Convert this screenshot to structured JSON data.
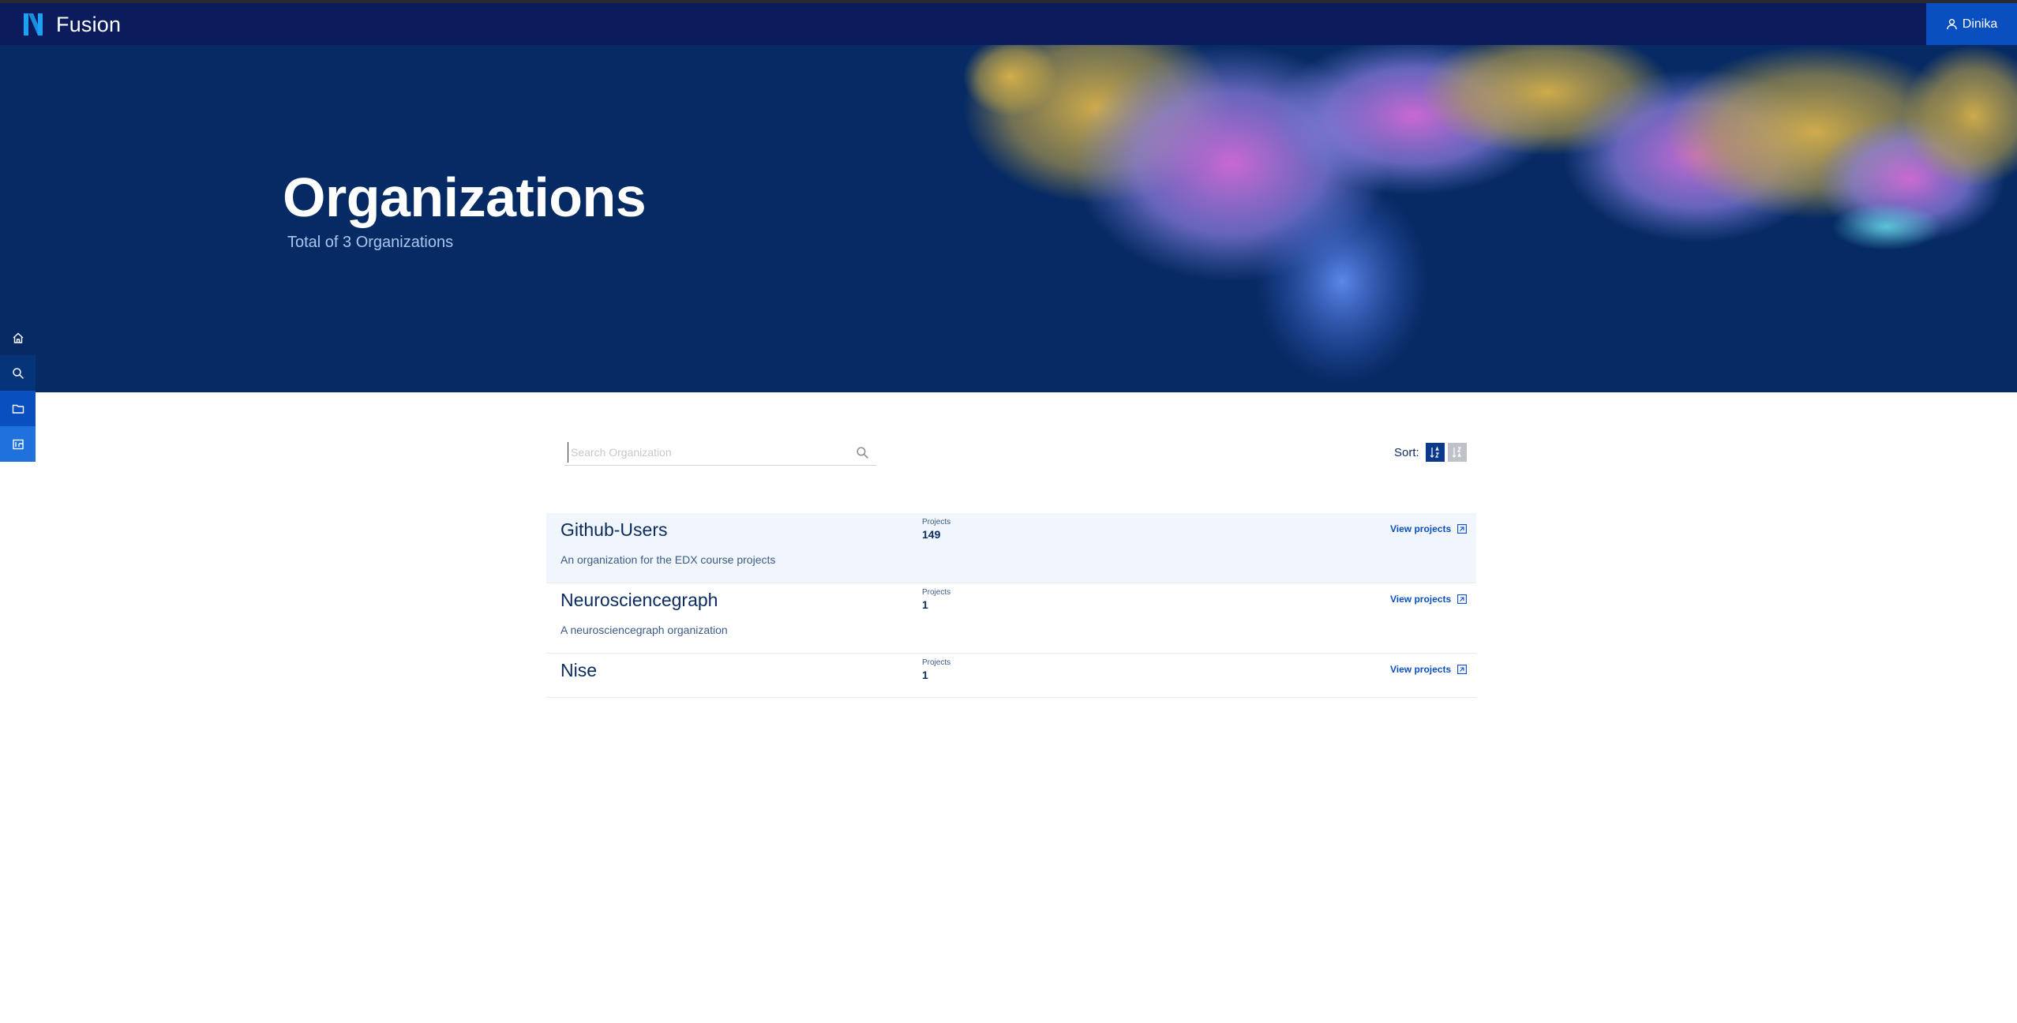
{
  "app": {
    "name": "Fusion",
    "brand_color": "#0b1b5c",
    "accent": "#0a4fbf"
  },
  "user": {
    "name": "Dinika",
    "icon": "user-icon"
  },
  "hero": {
    "title": "Organizations",
    "subtitle": "Total of 3 Organizations"
  },
  "sidebar": {
    "items": [
      {
        "icon": "home-icon"
      },
      {
        "icon": "search-icon"
      },
      {
        "icon": "folder-icon"
      },
      {
        "icon": "studio-icon"
      }
    ]
  },
  "search": {
    "placeholder": "Search Organization",
    "value": ""
  },
  "sort": {
    "label": "Sort:",
    "active": "ascending"
  },
  "organizations": [
    {
      "name": "Github-Users",
      "description": "An organization for the EDX course projects",
      "projects_label": "Projects",
      "projects": "149",
      "link": "View projects"
    },
    {
      "name": "Neurosciencegraph",
      "description": "A neurosciencegraph organization",
      "projects_label": "Projects",
      "projects": "1",
      "link": "View projects"
    },
    {
      "name": "Nise",
      "description": "",
      "projects_label": "Projects",
      "projects": "1",
      "link": "View projects"
    }
  ]
}
